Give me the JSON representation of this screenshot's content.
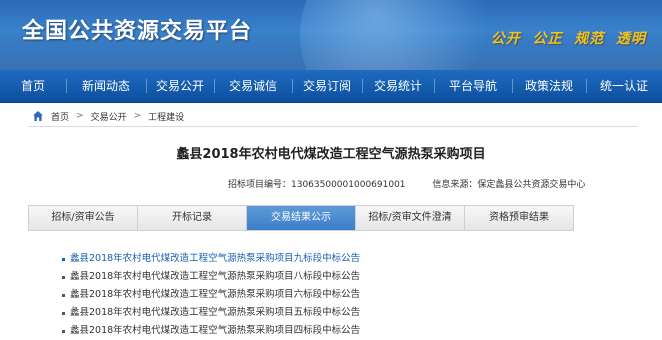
{
  "header": {
    "site_title": "全国公共资源交易平台",
    "slogan": "公开  公正  规范  透明"
  },
  "nav": {
    "items": [
      {
        "label": "首页",
        "width": 66
      },
      {
        "label": "新闻动态",
        "width": 80
      },
      {
        "label": "交易公开",
        "width": 68
      },
      {
        "label": "交易诚信",
        "width": 78
      },
      {
        "label": "交易订阅",
        "width": 70
      },
      {
        "label": "交易统计",
        "width": 72
      },
      {
        "label": "平台导航",
        "width": 78
      },
      {
        "label": "政策法规",
        "width": 74
      },
      {
        "label": "统一认证",
        "width": 76
      }
    ]
  },
  "breadcrumb": {
    "home": "首页",
    "level1": "交易公开",
    "level2": "工程建设"
  },
  "project": {
    "title": "蠡县2018年农村电代煤改造工程空气源热泵采购项目",
    "code_label": "招标项目编号：13063500001000691001",
    "source_label": "信息来源：保定蠡县公共资源交易中心"
  },
  "tabs": [
    {
      "label": "招标/资审公告",
      "active": false
    },
    {
      "label": "开标记录",
      "active": false
    },
    {
      "label": "交易结果公示",
      "active": true
    },
    {
      "label": "招标/资审文件澄清",
      "active": false
    },
    {
      "label": "资格预审结果",
      "active": false
    }
  ],
  "notices": [
    {
      "text": "蠡县2018年农村电代煤改造工程空气源热泵采购项目九标段中标公告",
      "highlight": true
    },
    {
      "text": "蠡县2018年农村电代煤改造工程空气源热泵采购项目八标段中标公告",
      "highlight": false
    },
    {
      "text": "蠡县2018年农村电代煤改造工程空气源热泵采购项目六标段中标公告",
      "highlight": false
    },
    {
      "text": "蠡县2018年农村电代煤改造工程空气源热泵采购项目五标段中标公告",
      "highlight": false
    },
    {
      "text": "蠡县2018年农村电代煤改造工程空气源热泵采购项目四标段中标公告",
      "highlight": false
    }
  ],
  "icons": {
    "home": "home-icon"
  },
  "colors": {
    "nav_bg": "#0d4f9e",
    "active_tab": "#3b7fc9",
    "slogan": "#f3c31d",
    "highlight_link": "#1a5fb4"
  }
}
